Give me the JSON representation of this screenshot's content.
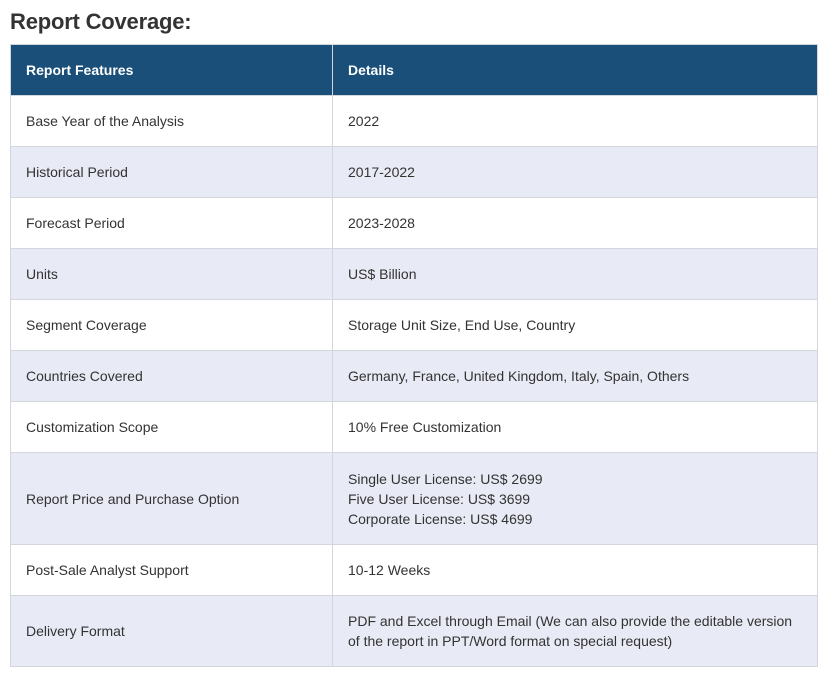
{
  "page": {
    "title": "Report Coverage:"
  },
  "table": {
    "headers": [
      "Report Features",
      "Details"
    ],
    "rows": [
      {
        "feature": "Base Year of the Analysis",
        "details": [
          "2022"
        ]
      },
      {
        "feature": "Historical Period",
        "details": [
          "2017-2022"
        ]
      },
      {
        "feature": "Forecast Period",
        "details": [
          "2023-2028"
        ]
      },
      {
        "feature": "Units",
        "details": [
          "US$ Billion"
        ]
      },
      {
        "feature": "Segment Coverage",
        "details": [
          "Storage Unit Size, End Use, Country"
        ]
      },
      {
        "feature": "Countries Covered",
        "details": [
          "Germany, France, United Kingdom, Italy, Spain, Others"
        ]
      },
      {
        "feature": "Customization Scope",
        "details": [
          "10% Free Customization"
        ]
      },
      {
        "feature": "Report Price and Purchase Option",
        "details": [
          "Single User License: US$ 2699",
          "Five User License: US$ 3699",
          "Corporate License: US$ 4699"
        ]
      },
      {
        "feature": "Post-Sale Analyst Support",
        "details": [
          "10-12 Weeks"
        ]
      },
      {
        "feature": "Delivery Format",
        "details": [
          "PDF and Excel through Email (We can also provide the editable version",
          "of the report in PPT/Word format on special request)"
        ]
      }
    ]
  },
  "colors": {
    "header_bg": "#1a4f79",
    "row_alt_bg": "#e8eaf5",
    "border": "#d3d6dc",
    "text": "#333333"
  }
}
